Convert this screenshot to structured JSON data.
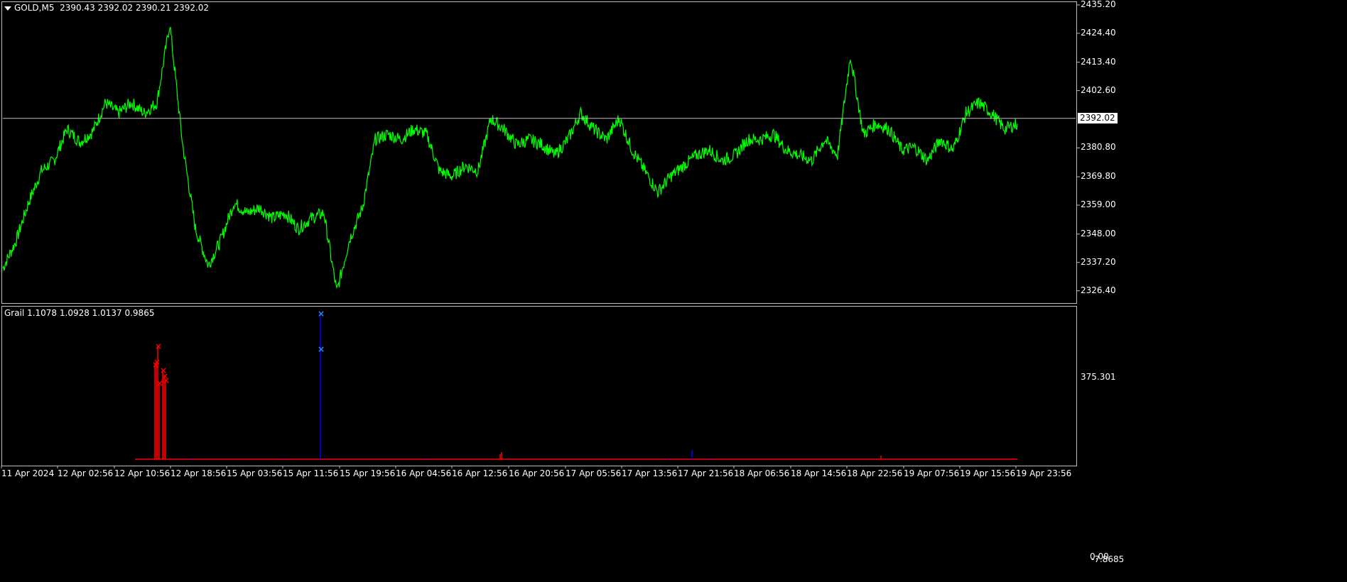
{
  "main_chart": {
    "symbol": "GOLD,M5",
    "ohlc": "2390.43 2392.02 2390.21 2392.02",
    "current_price_label": "2392.02",
    "line_color": "#00ff00",
    "y_ticks": [
      "2435.20",
      "2424.40",
      "2413.40",
      "2402.60",
      "2380.80",
      "2369.80",
      "2359.00",
      "2348.00",
      "2337.20",
      "2326.40"
    ],
    "y_tick_values": [
      2435.2,
      2424.4,
      2413.4,
      2402.6,
      2380.8,
      2369.8,
      2359.0,
      2348.0,
      2337.2,
      2326.4
    ],
    "current_price": 2392.02
  },
  "indicator": {
    "title": "Grail 1.1078 1.0928 1.0137 0.9865",
    "y_top_label": "375.301",
    "y_zero_label": "0.00",
    "y_bottom_label": "-7.8685",
    "colors": {
      "sell": "#ff0000",
      "buy": "#0000ff",
      "marker_buy": "#1e90ff"
    }
  },
  "x_axis": {
    "labels": [
      "11 Apr 2024",
      "12 Apr 02:56",
      "12 Apr 10:56",
      "12 Apr 18:56",
      "15 Apr 03:56",
      "15 Apr 11:56",
      "15 Apr 19:56",
      "16 Apr 04:56",
      "16 Apr 12:56",
      "16 Apr 20:56",
      "17 Apr 05:56",
      "17 Apr 13:56",
      "17 Apr 21:56",
      "18 Apr 06:56",
      "18 Apr 14:56",
      "18 Apr 22:56",
      "19 Apr 07:56",
      "19 Apr 15:56",
      "19 Apr 23:56"
    ]
  },
  "chart_data": [
    {
      "type": "line",
      "title": "GOLD,M5",
      "series": [
        {
          "values": [
            2335,
            2345,
            2360,
            2372,
            2376,
            2388,
            2383,
            2387,
            2398,
            2394,
            2398,
            2394,
            2398,
            2428,
            2382,
            2350,
            2336,
            2346,
            2360,
            2356,
            2358,
            2354,
            2356,
            2350,
            2354,
            2356,
            2326,
            2346,
            2358,
            2384,
            2386,
            2384,
            2388,
            2386,
            2372,
            2370,
            2374,
            2372,
            2392,
            2388,
            2382,
            2384,
            2382,
            2378,
            2384,
            2394,
            2388,
            2384,
            2392,
            2380,
            2372,
            2364,
            2370,
            2374,
            2378,
            2380,
            2376,
            2378,
            2384,
            2384,
            2386,
            2380,
            2378,
            2376,
            2384,
            2378,
            2416,
            2386,
            2390,
            2388,
            2380,
            2381,
            2376,
            2384,
            2380,
            2394,
            2398,
            2394,
            2388,
            2390
          ]
        }
      ],
      "ylim": [
        2322,
        2436
      ]
    }
  ]
}
